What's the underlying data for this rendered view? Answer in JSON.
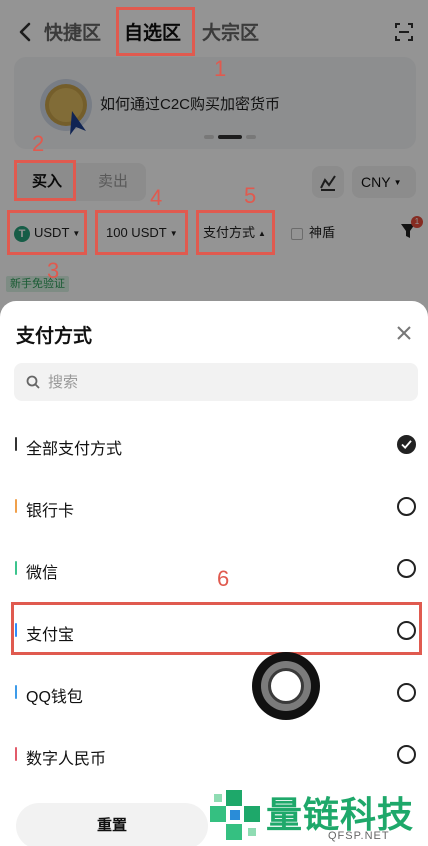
{
  "nav": {
    "tabs": [
      "快捷区",
      "自选区",
      "大宗区"
    ],
    "active_tab": "自选区"
  },
  "banner": {
    "text": "如何通过C2C购买加密货币"
  },
  "trade_switch": {
    "buy": "买入",
    "sell": "卖出"
  },
  "currency": "CNY",
  "filters": {
    "coin": "USDT",
    "amount": "100 USDT",
    "payment": "支付方式",
    "shield": "神盾",
    "filter_badge": "1"
  },
  "newbie_tag": "新手免验证",
  "sheet": {
    "title": "支付方式",
    "search_placeholder": "搜索",
    "options": [
      {
        "label": "全部支付方式",
        "checked": true,
        "bar_color": "#333333"
      },
      {
        "label": "银行卡",
        "checked": false,
        "bar_color": "#f0a04b"
      },
      {
        "label": "微信",
        "checked": false,
        "bar_color": "#3cc48d"
      },
      {
        "label": "支付宝",
        "checked": false,
        "bar_color": "#2f8cff"
      },
      {
        "label": "QQ钱包",
        "checked": false,
        "bar_color": "#3d9be9"
      },
      {
        "label": "数字人民币",
        "checked": false,
        "bar_color": "#e25b6a"
      }
    ],
    "reset_label": "重置"
  },
  "annotations": [
    "1",
    "2",
    "3",
    "4",
    "5",
    "6"
  ],
  "watermark": {
    "title": "量链科技",
    "subtitle": "QFSP.NET"
  },
  "colors": {
    "annotation": "#e05a4f",
    "watermark": "#1ea86a",
    "usdt": "#26a17b"
  }
}
